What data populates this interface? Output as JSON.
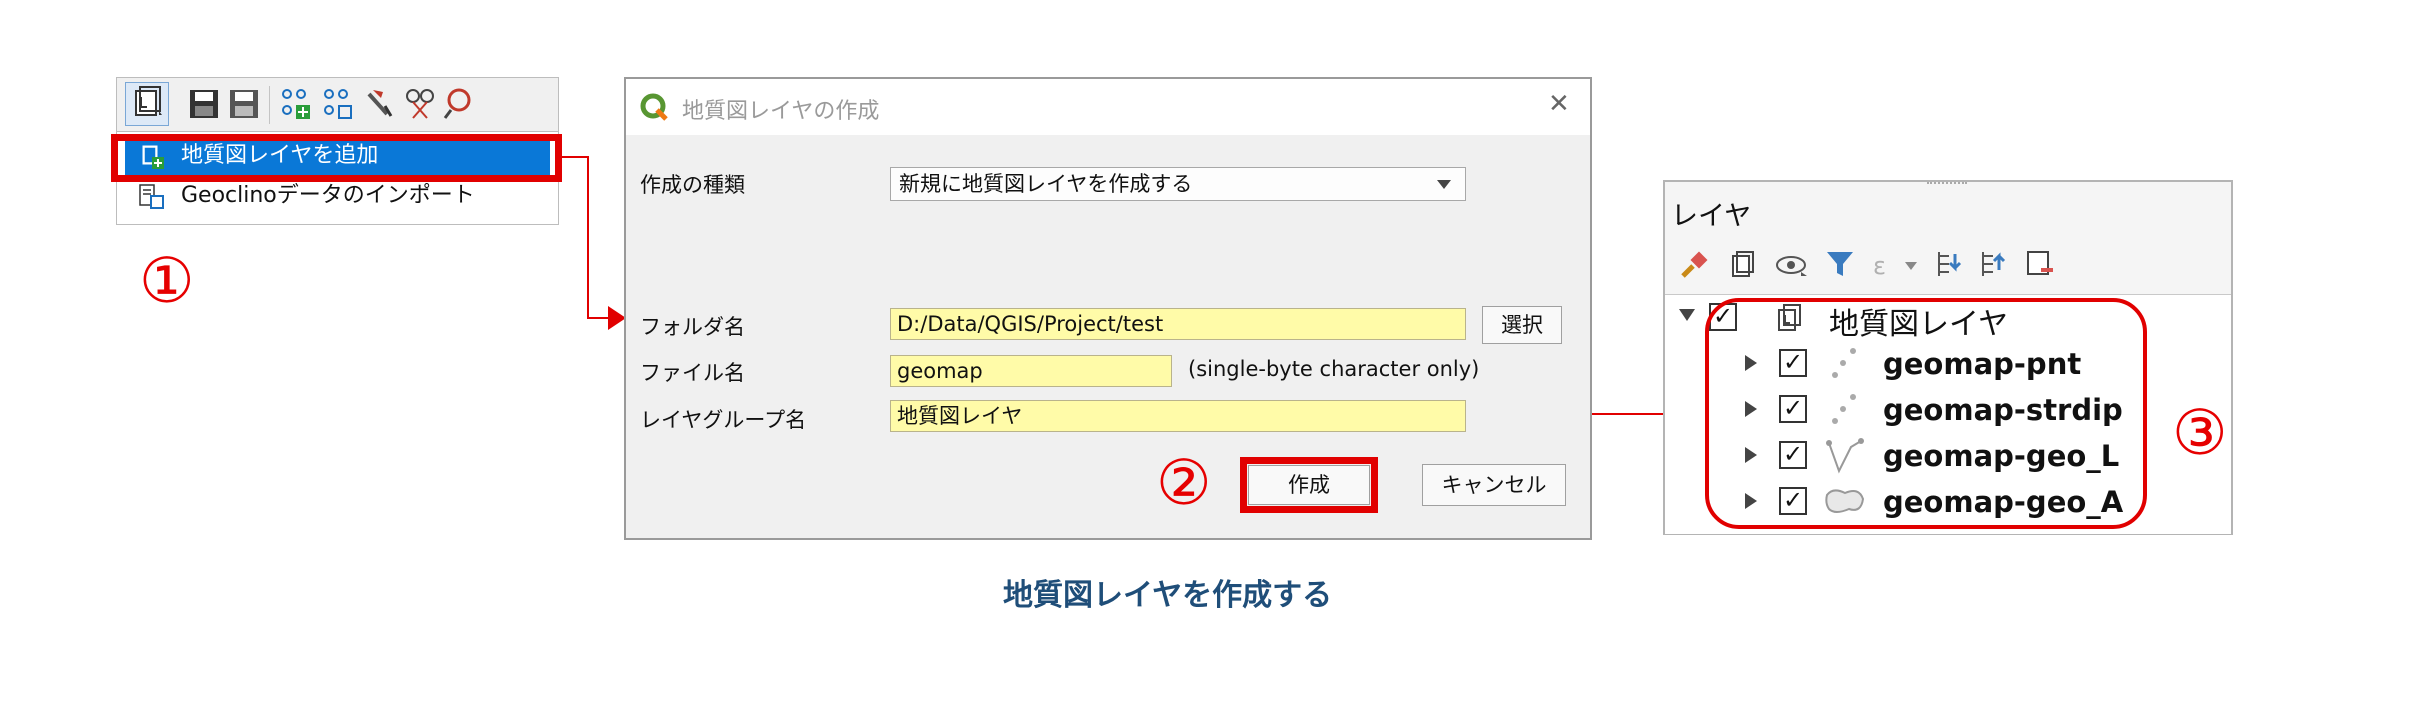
{
  "panel1": {
    "toolbar_icons": [
      "add-geologic-layer-icon",
      "save-icon",
      "save-as-icon",
      "add-point-icon",
      "add-point-alt-icon",
      "pick-icon",
      "scissors-icon",
      "zoom-icon"
    ],
    "menu": [
      {
        "label": "地質図レイヤを追加",
        "icon": "add-geologic-layer-icon",
        "selected": true
      },
      {
        "label": "Geoclinoデータのインポート",
        "icon": "import-icon",
        "selected": false
      }
    ],
    "step": "①"
  },
  "dialog": {
    "title": "地質図レイヤの作成",
    "close_glyph": "✕",
    "type_label": "作成の種類",
    "type_value": "新規に地質図レイヤを作成する",
    "folder_label": "フォルダ名",
    "folder_value": "D:/Data/QGIS/Project/test",
    "select_button": "選択",
    "file_label": "ファイル名",
    "file_value": "geomap",
    "file_note": "(single-byte character only)",
    "group_label": "レイヤグループ名",
    "group_value": "地質図レイヤ",
    "create_button": "作成",
    "cancel_button": "キャンセル",
    "step": "②"
  },
  "layers": {
    "title": "レイヤ",
    "group_name": "地質図レイヤ",
    "items": [
      {
        "name": "geomap-pnt",
        "icon": "point-layer-icon"
      },
      {
        "name": "geomap-strdip",
        "icon": "point-layer-icon"
      },
      {
        "name": "geomap-geo_L",
        "icon": "line-layer-icon"
      },
      {
        "name": "geomap-geo_A",
        "icon": "polygon-layer-icon"
      }
    ],
    "check_glyph": "✓",
    "step": "③"
  },
  "caption": "地質図レイヤを作成する",
  "colors": {
    "highlight_red": "#e10000",
    "selected_blue": "#0a78d7",
    "field_yellow": "#fffba8",
    "caption_blue": "#1f4e79"
  }
}
